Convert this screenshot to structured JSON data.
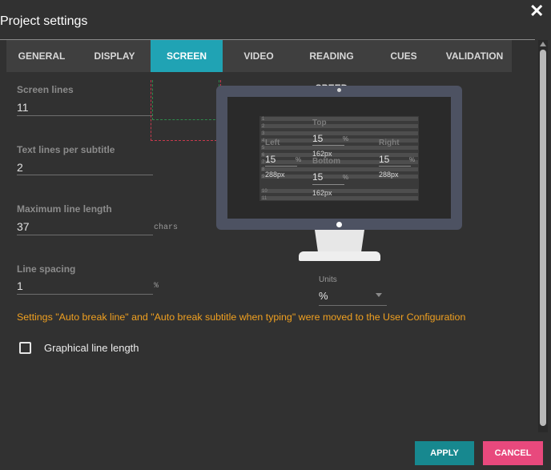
{
  "dialog": {
    "title": "Project settings",
    "close_icon": "close-icon"
  },
  "tabs": [
    {
      "label": "GENERAL"
    },
    {
      "label": "DISPLAY"
    },
    {
      "label": "SCREEN",
      "active": true
    },
    {
      "label": "VIDEO"
    },
    {
      "label": "READING SPEED"
    },
    {
      "label": "CUES"
    },
    {
      "label": "VALIDATION"
    }
  ],
  "fields": {
    "screen_lines": {
      "label": "Screen lines",
      "value": "11"
    },
    "text_lines": {
      "label": "Text lines per subtitle",
      "value": "2"
    },
    "max_length": {
      "label": "Maximum line length",
      "value": "37",
      "suffix": "chars"
    },
    "line_spacing": {
      "label": "Line spacing",
      "value": "1",
      "suffix": "%"
    }
  },
  "margins": {
    "top": {
      "label": "Top",
      "value": "15",
      "unit": "%",
      "px": "162px"
    },
    "left": {
      "label": "Left",
      "value": "15",
      "unit": "%",
      "px": "288px"
    },
    "right": {
      "label": "Right",
      "value": "15",
      "unit": "%",
      "px": "288px"
    },
    "bottom": {
      "label": "Bottom",
      "value": "15",
      "unit": "%",
      "px": "162px"
    }
  },
  "preview": {
    "line_numbers": [
      "1",
      "2",
      "3",
      "4",
      "5",
      "6",
      "7",
      "8",
      "9",
      "10",
      "11"
    ]
  },
  "units": {
    "label": "Units",
    "value": "%"
  },
  "notice": "Settings \"Auto break line\" and \"Auto break subtitle when typing\" were moved to the User Configuration",
  "graphical_line_length": {
    "label": "Graphical line length",
    "checked": false
  },
  "buttons": {
    "apply": "APPLY",
    "cancel": "CANCEL"
  },
  "colors": {
    "accent": "#20a3b4",
    "warning": "#f0a020",
    "cancel": "#e8497d",
    "apply": "#17888f"
  }
}
